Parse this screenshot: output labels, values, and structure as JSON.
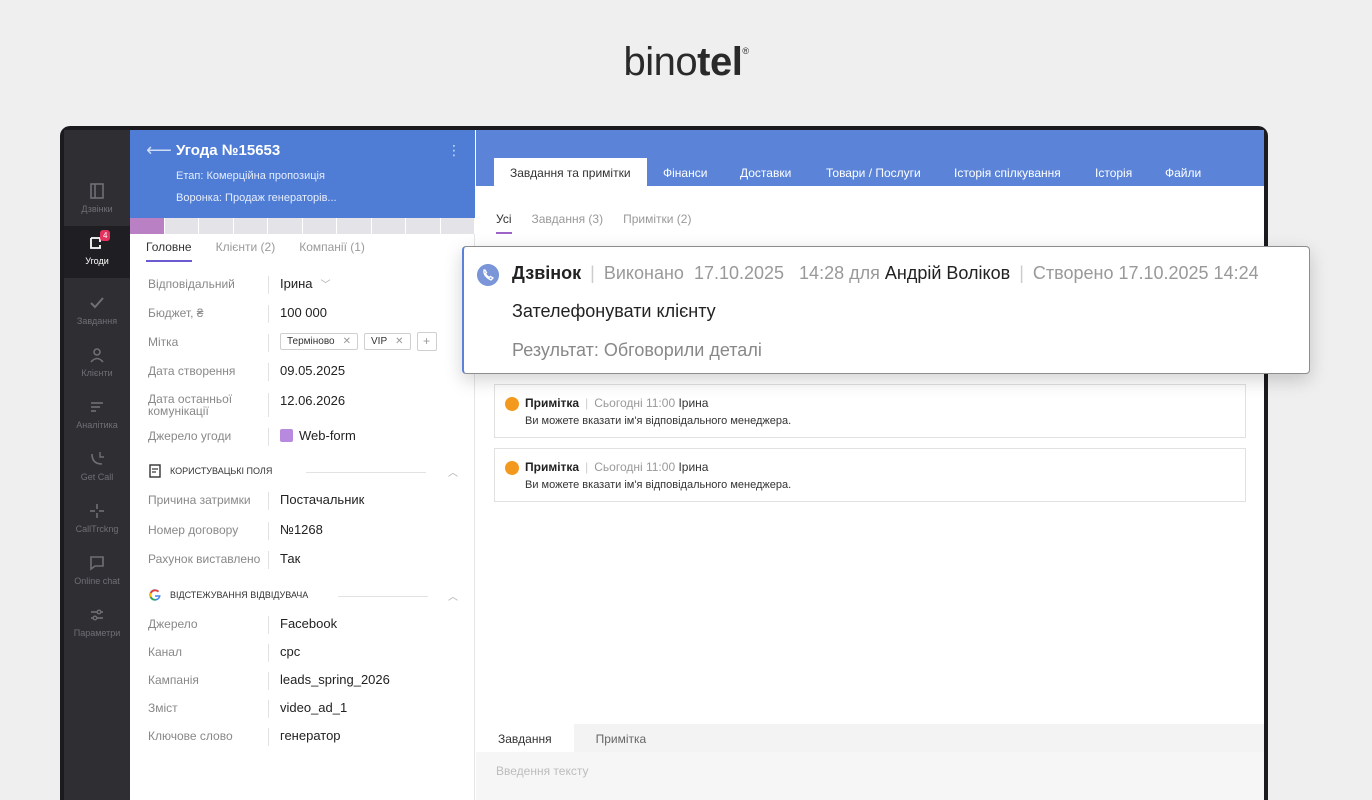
{
  "logo": {
    "light": "bino",
    "bold": "tel",
    "mark": "®"
  },
  "sidebar": {
    "items": [
      {
        "label": "Дзвінки",
        "icon": "phone-book-icon"
      },
      {
        "label": "Угоди",
        "icon": "deals-icon",
        "badge": "4"
      },
      {
        "label": "Завдання",
        "icon": "check-icon"
      },
      {
        "label": "Клієнти",
        "icon": "person-icon"
      },
      {
        "label": "Аналітика",
        "icon": "analytics-icon"
      },
      {
        "label": "Get Call",
        "icon": "get-call-icon"
      },
      {
        "label": "CallTrckng",
        "icon": "calltracking-icon"
      },
      {
        "label": "Online chat",
        "icon": "chat-icon"
      },
      {
        "label": "Параметри",
        "icon": "settings-icon"
      }
    ]
  },
  "deal": {
    "back": "⟵",
    "title": "Угода №15653",
    "menu": "⋮",
    "stage": "Етап: Комерційна пропозиція",
    "funnel": "Воронка: Продаж генераторів...",
    "tabs": [
      "Головне",
      "Клієнти (2)",
      "Компанії (1)"
    ],
    "fields": {
      "responsible": {
        "label": "Відповідальний",
        "value": "Ірина"
      },
      "budget": {
        "label": "Бюджет, ₴",
        "value": "100 000"
      },
      "tags_label": "Мітка",
      "tags": [
        "Терміново",
        "VIP"
      ],
      "created": {
        "label": "Дата створення",
        "value": "09.05.2025"
      },
      "last_comm": {
        "label": "Дата останньої комунікації",
        "value": "12.06.2026"
      },
      "source": {
        "label": "Джерело угоди",
        "value": "Web-form"
      }
    },
    "custom_section": "Користувацькі поля",
    "custom": {
      "delay": {
        "label": "Причина затримки",
        "value": "Постачальник"
      },
      "contract": {
        "label": "Номер договору",
        "value": "№1268"
      },
      "invoice": {
        "label": "Рахунок виставлено",
        "value": "Так"
      }
    },
    "tracking_section": "Відстежування відвідувача",
    "tracking": {
      "source": {
        "label": "Джерело",
        "value": "Facebook"
      },
      "channel": {
        "label": "Канал",
        "value": "cpc"
      },
      "campaign": {
        "label": "Кампанія",
        "value": "leads_spring_2026"
      },
      "content": {
        "label": "Зміст",
        "value": "video_ad_1"
      },
      "keyword": {
        "label": "Ключове слово",
        "value": "генератор"
      }
    }
  },
  "right": {
    "tabs": [
      "Завдання та примітки",
      "Фінанси",
      "Доставки",
      "Товари / Послуги",
      "Історія спілкування",
      "Історія",
      "Файли"
    ],
    "subtabs": [
      "Усі",
      "Завдання (3)",
      "Примітки (2)"
    ],
    "notes": [
      {
        "type": "Примітка",
        "time": "Сьогодні 11:00",
        "author": "Ірина",
        "text": "Ви можете вказати ім'я відповідального менеджера."
      },
      {
        "type": "Примітка",
        "time": "Сьогодні 11:00",
        "author": "Ірина",
        "text": "Ви можете вказати ім'я відповідального менеджера."
      }
    ],
    "bottom_tabs": [
      "Завдання",
      "Примітка"
    ],
    "input_placeholder": "Введення тексту"
  },
  "popup": {
    "type": "Дзвінок",
    "status": "Виконано",
    "date": "17.10.2025",
    "time": "14:28",
    "for": "для",
    "person": "Андрій Воліков",
    "created": "Створено 17.10.2025 14:24",
    "title": "Зателефонувати клієнту",
    "result": "Результат: Обговорили деталі"
  },
  "colors": {
    "accent": "#5b84d8",
    "header": "#4f7dd6",
    "sidebar": "#2e2e33",
    "note_icon": "#f39a1e",
    "stage_done": "#b980c4"
  }
}
